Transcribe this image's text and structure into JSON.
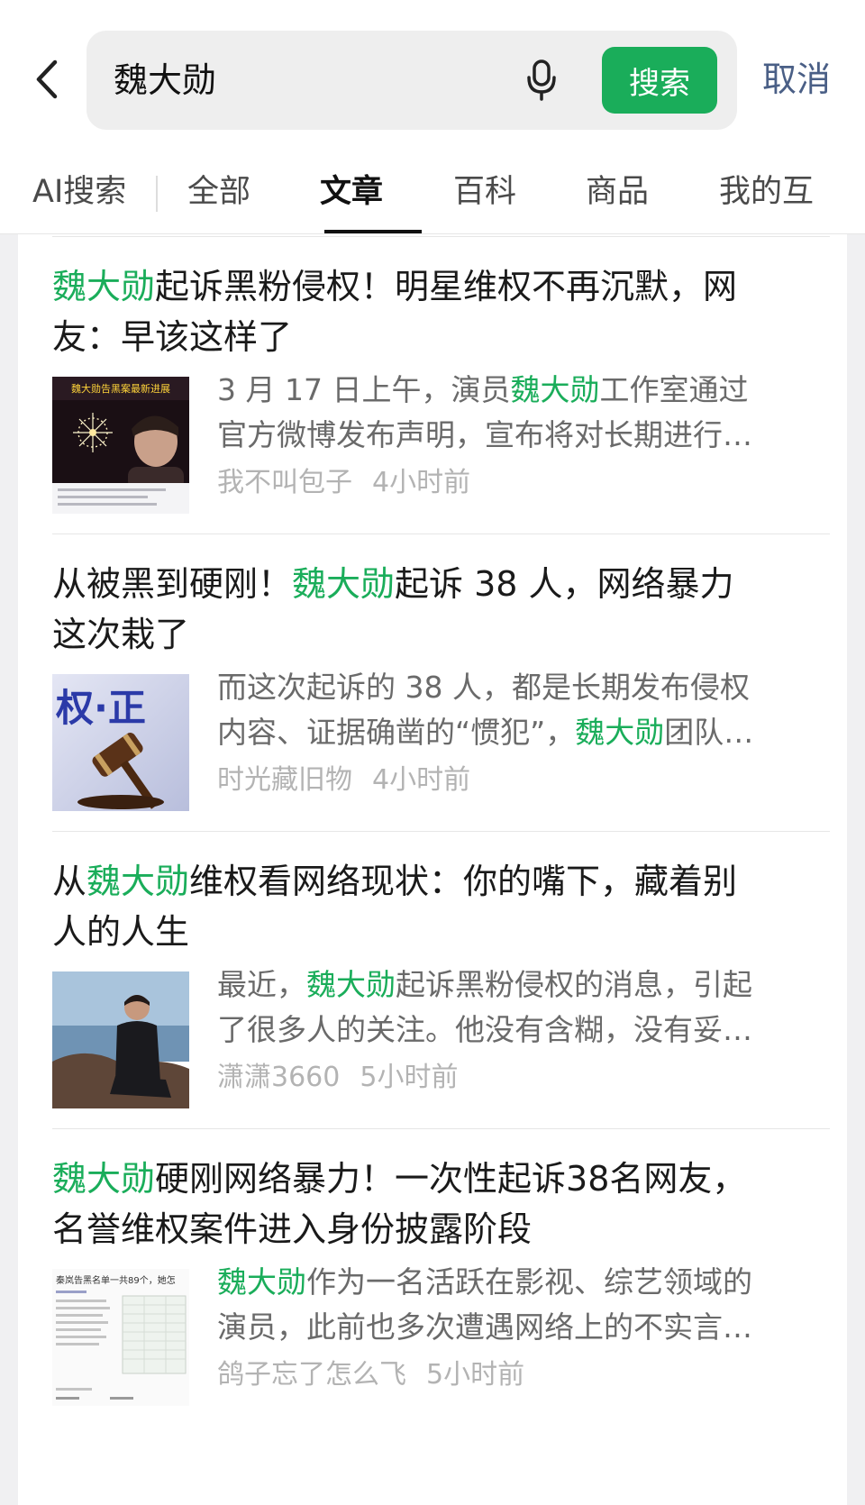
{
  "search": {
    "query": "魏大勋",
    "button_label": "搜索",
    "cancel_label": "取消"
  },
  "tabs": [
    {
      "label": "AI搜索"
    },
    {
      "label": "全部"
    },
    {
      "label": "文章"
    },
    {
      "label": "百科"
    },
    {
      "label": "商品"
    },
    {
      "label": "我的互"
    }
  ],
  "active_tab": "文章",
  "colors": {
    "accent": "#1aad5a",
    "cancel": "#4a5f86"
  },
  "results": [
    {
      "title_l1": [
        {
          "t": "魏大勋",
          "hl": true
        },
        {
          "t": "起诉黑粉侵权！明星维权不再沉默，网"
        }
      ],
      "title_l2": [
        {
          "t": "友：早该这样了"
        }
      ],
      "thumb_text": "魏大勋告黑案最新进展",
      "summary_l1": [
        {
          "t": "3 月 17 日上午，演员"
        },
        {
          "t": "魏大勋",
          "hl": true
        },
        {
          "t": "工作室通过"
        }
      ],
      "summary_l2": [
        {
          "t": "官方微博发布声明，宣布将对长期进行…"
        }
      ],
      "author": "我不叫包子",
      "time": "4小时前"
    },
    {
      "title_l1": [
        {
          "t": "从被黑到硬刚！"
        },
        {
          "t": "魏大勋",
          "hl": true
        },
        {
          "t": "起诉 38 人，网络暴力"
        }
      ],
      "title_l2": [
        {
          "t": "这次栽了"
        }
      ],
      "thumb_text": "权·正",
      "summary_l1": [
        {
          "t": "而这次起诉的 38 人，都是长期发布侵权"
        }
      ],
      "summary_l2": [
        {
          "t": "内容、证据确凿的“惯犯”，"
        },
        {
          "t": "魏大勋",
          "hl": true
        },
        {
          "t": "团队…"
        }
      ],
      "author": "时光藏旧物",
      "time": "4小时前"
    },
    {
      "title_l1": [
        {
          "t": "从"
        },
        {
          "t": "魏大勋",
          "hl": true
        },
        {
          "t": "维权看网络现状：你的嘴下，藏着别"
        }
      ],
      "title_l2": [
        {
          "t": "人的人生"
        }
      ],
      "thumb_text": "",
      "summary_l1": [
        {
          "t": "最近，"
        },
        {
          "t": "魏大勋",
          "hl": true
        },
        {
          "t": "起诉黑粉侵权的消息，引起"
        }
      ],
      "summary_l2": [
        {
          "t": "了很多人的关注。他没有含糊，没有妥…"
        }
      ],
      "author": "潇潇3660",
      "time": "5小时前"
    },
    {
      "title_l1": [
        {
          "t": "魏大勋",
          "hl": true
        },
        {
          "t": "硬刚网络暴力！一次性起诉38名网友，"
        }
      ],
      "title_l2": [
        {
          "t": "名誉维权案件进入身份披露阶段"
        }
      ],
      "thumb_text": "秦岚告黑名单一共89个，她怎",
      "summary_l1": [
        {
          "t": "魏大勋",
          "hl": true
        },
        {
          "t": "作为一名活跃在影视、综艺领域的"
        }
      ],
      "summary_l2": [
        {
          "t": "演员，此前也多次遭遇网络上的不实言…"
        }
      ],
      "author": "鸽子忘了怎么飞",
      "time": "5小时前"
    }
  ]
}
